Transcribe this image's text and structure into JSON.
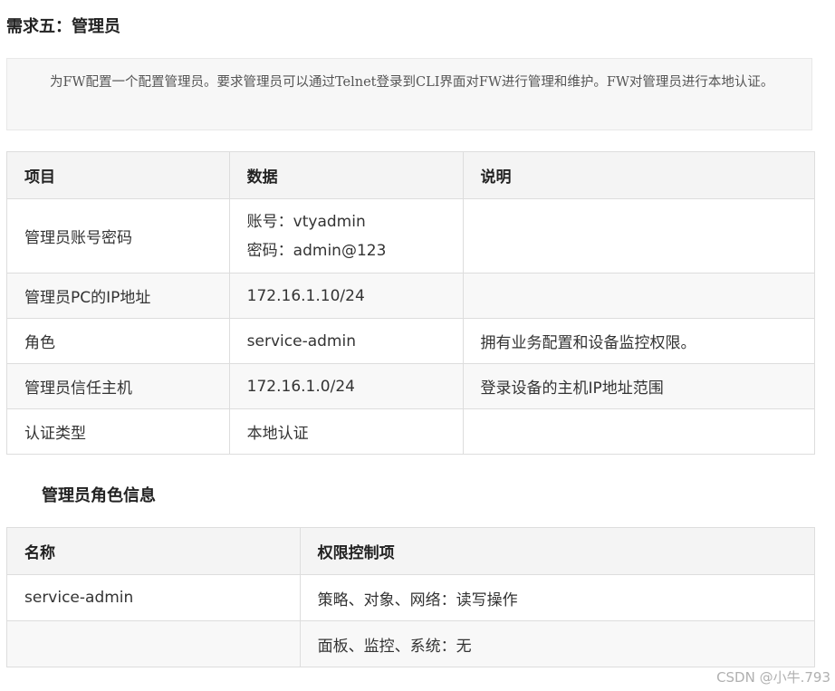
{
  "heading": "需求五：管理员",
  "note": "为FW配置一个配置管理员。要求管理员可以通过Telnet登录到CLI界面对FW进行管理和维护。FW对管理员进行本地认证。",
  "table1": {
    "headers": [
      "项目",
      "数据",
      "说明"
    ],
    "rows": [
      {
        "item": "管理员账号密码",
        "data_lines": [
          "账号：vtyadmin",
          "密码：admin@123"
        ],
        "desc": ""
      },
      {
        "item": "管理员PC的IP地址",
        "data": "172.16.1.10/24",
        "desc": ""
      },
      {
        "item": "角色",
        "data": "service-admin",
        "desc": "拥有业务配置和设备监控权限。"
      },
      {
        "item": "管理员信任主机",
        "data": "172.16.1.0/24",
        "desc": "登录设备的主机IP地址范围"
      },
      {
        "item": "认证类型",
        "data": "本地认证",
        "desc": ""
      }
    ]
  },
  "subheading": "管理员角色信息",
  "table2": {
    "headers": [
      "名称",
      "权限控制项"
    ],
    "rows": [
      {
        "name": "service-admin",
        "perm": "策略、对象、网络：读写操作"
      },
      {
        "name": "",
        "perm": "面板、监控、系统：无"
      }
    ]
  },
  "watermark": "CSDN @小牛.793"
}
